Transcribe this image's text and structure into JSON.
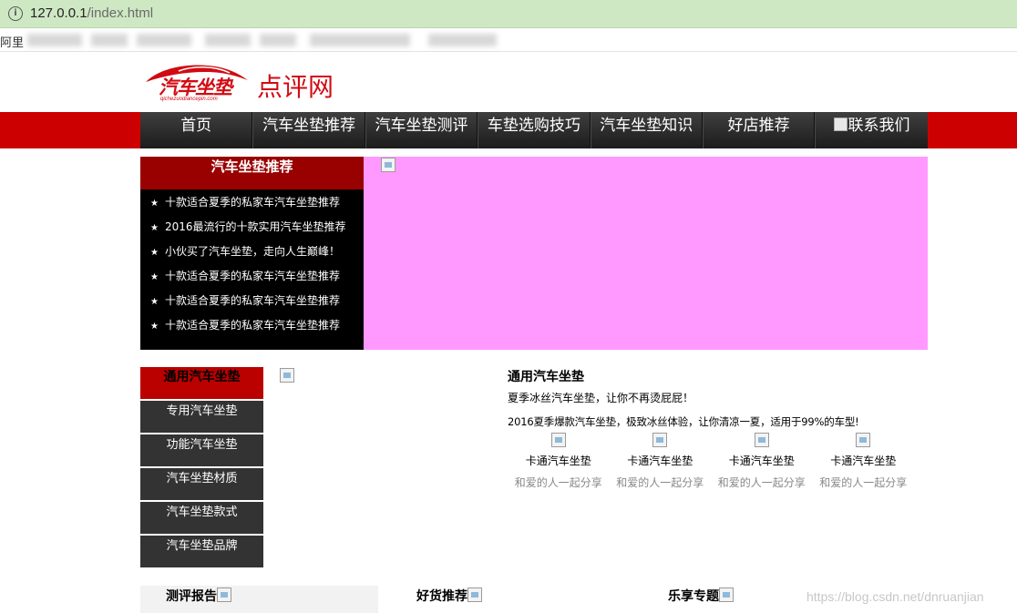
{
  "browser": {
    "url_host": "127.0.0.1",
    "url_path": "/index.html",
    "bookmark_first": "阿里"
  },
  "header": {
    "logo_cn": "汽车坐垫",
    "logo_pinyin": "qichezuodiancepin.com",
    "site_title": "点评网"
  },
  "nav": {
    "items": [
      "首页",
      "汽车坐垫推荐",
      "汽车坐垫测评",
      "车垫选购技巧",
      "汽车坐垫知识",
      "好店推荐",
      "联系我们"
    ]
  },
  "recommend": {
    "title": "汽车坐垫推荐",
    "items": [
      "十款适合夏季的私家车汽车坐垫推荐",
      "2016最流行的十款实用汽车坐垫推荐",
      "小伙买了汽车坐垫，走向人生巅峰！",
      "十款适合夏季的私家车汽车坐垫推荐",
      "十款适合夏季的私家车汽车坐垫推荐",
      "十款适合夏季的私家车汽车坐垫推荐"
    ]
  },
  "side_menu": {
    "head": "通用汽车坐垫",
    "items": [
      "专用汽车坐垫",
      "功能汽车坐垫",
      "汽车坐垫材质",
      "汽车坐垫款式",
      "汽车坐垫品牌"
    ]
  },
  "product": {
    "title": "通用汽车坐垫",
    "line1": "夏季冰丝汽车坐垫，让你不再烫屁屁！",
    "line2": "2016夏季爆款汽车坐垫，极致冰丝体验，让你清凉一夏，适用于99%的车型!",
    "cards": [
      {
        "name": "卡通汽车坐垫",
        "desc": "和爱的人一起分享"
      },
      {
        "name": "卡通汽车坐垫",
        "desc": "和爱的人一起分享"
      },
      {
        "name": "卡通汽车坐垫",
        "desc": "和爱的人一起分享"
      },
      {
        "name": "卡通汽车坐垫",
        "desc": "和爱的人一起分享"
      }
    ]
  },
  "sections": [
    "测评报告",
    "好货推荐",
    "乐享专题"
  ],
  "watermark": "https://blog.csdn.net/dnruanjian",
  "colors": {
    "brand_red": "#cc0000",
    "banner_pink": "#ff99ff",
    "nav_dark": "#2a2a2a"
  }
}
